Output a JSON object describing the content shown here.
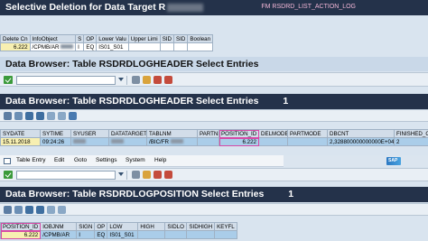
{
  "panel1": {
    "title": "Selective Deletion for Data Target R",
    "fm_label": "FM RSDRD_LIST_ACTION_LOG",
    "headers": [
      "Delete Cn",
      "InfoObject",
      "S",
      "OP",
      "Lower Valu",
      "Upper Limi",
      "SID",
      "SID",
      "Boolean"
    ],
    "row": [
      "6.222",
      "/CPMB/AR",
      "I",
      "EQ",
      "IS01_S01",
      "",
      "",
      "",
      ""
    ]
  },
  "panel2": {
    "title": "Data Browser: Table RSDRDLOGHEADER Select Entries",
    "count": "1",
    "headers": [
      "SYDATE",
      "SYTIME",
      "SYUSER",
      "DATATARGET",
      "TABLNM",
      "PARTNM",
      "POSITION_ID",
      "DELMODE",
      "PARTMODE",
      "DBCNT",
      "FINISHED_ON"
    ],
    "row": [
      "15.11.2018",
      "09:24:26",
      "",
      "",
      "/BIC/FR",
      "",
      "6.222",
      "",
      "",
      "2,328800000000000E+04",
      "2"
    ]
  },
  "menubar": {
    "items": [
      "Table Entry",
      "Edit",
      "Goto",
      "Settings",
      "System",
      "Help"
    ]
  },
  "panel3": {
    "title": "Data Browser: Table RSDRDLOGPOSITION Select Entries",
    "count": "1",
    "headers": [
      "POSITION_ID",
      "IOBJNM",
      "SIGN",
      "OP",
      "LOW",
      "HIGH",
      "SIDLO",
      "SIDHIGH",
      "KEYFL"
    ],
    "row": [
      "6.222",
      "/CPMB/AR",
      "I",
      "EQ",
      "IS01_S01",
      "",
      "",
      "",
      ""
    ]
  },
  "colors": {
    "title_dark": "#24324a",
    "highlight_outline": "#d64aa6",
    "selected_row": "#aacde9",
    "yellow_key": "#f7efb1"
  }
}
